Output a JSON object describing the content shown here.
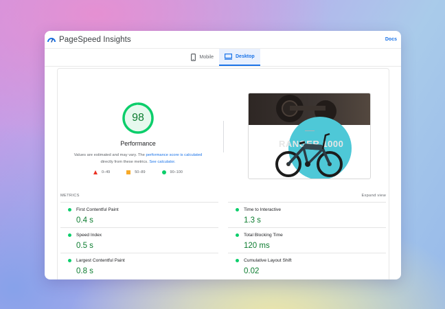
{
  "header": {
    "title": "PageSpeed Insights",
    "docs_label": "Docs"
  },
  "tabs": [
    {
      "label": "Mobile",
      "active": false
    },
    {
      "label": "Desktop",
      "active": true
    }
  ],
  "performance": {
    "score": "98",
    "score_value": 98,
    "title": "Performance",
    "note_prefix": "Values are estimated and may vary. The ",
    "note_link1": "performance score is calculated",
    "note_middle": "directly from these metrics. ",
    "note_link2": "See calculator.",
    "legend": [
      {
        "range": "0–49",
        "color": "#eb3223"
      },
      {
        "range": "50–89",
        "color": "#f7a928"
      },
      {
        "range": "90–100",
        "color": "#0cce6b"
      }
    ]
  },
  "screenshot": {
    "overlay_text": "RANGER 1000"
  },
  "metrics": {
    "heading": "METRICS",
    "expand_label": "Expand view",
    "items": [
      {
        "label": "First Contentful Paint",
        "value": "0.4 s"
      },
      {
        "label": "Time to Interactive",
        "value": "1.3 s"
      },
      {
        "label": "Speed Index",
        "value": "0.5 s"
      },
      {
        "label": "Total Blocking Time",
        "value": "120 ms"
      },
      {
        "label": "Largest Contentful Paint",
        "value": "0.8 s"
      },
      {
        "label": "Cumulative Layout Shift",
        "value": "0.02"
      }
    ]
  },
  "colors": {
    "accent": "#1a73e8",
    "good": "#0cce6b",
    "good_text": "#0c7c2f"
  }
}
